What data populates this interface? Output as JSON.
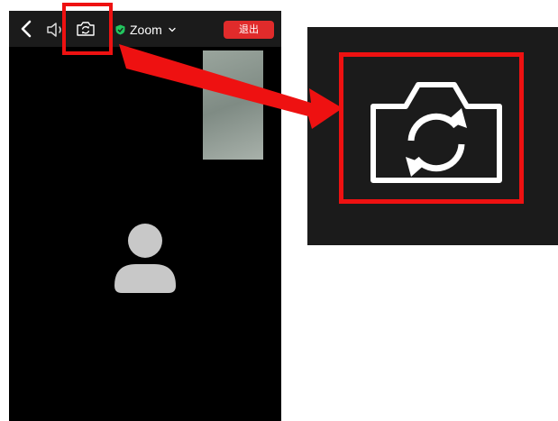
{
  "toolbar": {
    "back_icon": "chevron-left-icon",
    "speaker_icon": "speaker-icon",
    "switch_camera_icon": "switch-camera-icon",
    "meeting_title": "Zoom",
    "leave_label": "退出"
  },
  "colors": {
    "highlight": "#ee1111",
    "leave_button": "#e02b2b",
    "encryption_shield": "#22c55e",
    "topbar_bg": "#1b1b1b"
  },
  "annotation": {
    "callout_icon": "switch-camera-icon"
  }
}
